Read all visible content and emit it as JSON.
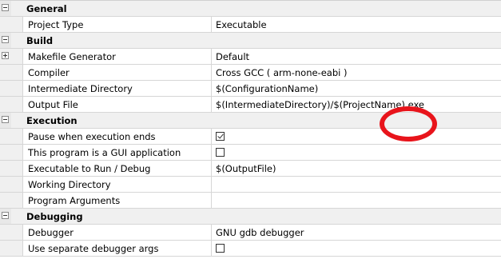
{
  "categories": {
    "general": {
      "label": "General"
    },
    "build": {
      "label": "Build"
    },
    "execution": {
      "label": "Execution"
    },
    "debugging": {
      "label": "Debugging"
    }
  },
  "properties": {
    "project_type": {
      "name": "Project Type",
      "value": "Executable"
    },
    "makefile_generator": {
      "name": "Makefile Generator",
      "value": "Default"
    },
    "compiler": {
      "name": "Compiler",
      "value": "Cross GCC ( arm-none-eabi )"
    },
    "intermediate_directory": {
      "name": "Intermediate Directory",
      "value": "$(ConfigurationName)"
    },
    "output_file": {
      "name": "Output File",
      "value": "$(IntermediateDirectory)/$(ProjectName).exe"
    },
    "pause_when_execution_ends": {
      "name": "Pause when execution ends",
      "checked": true
    },
    "gui_application": {
      "name": "This program is a GUI application",
      "checked": false
    },
    "executable_to_run": {
      "name": "Executable to Run / Debug",
      "value": "$(OutputFile)"
    },
    "working_directory": {
      "name": "Working Directory",
      "value": ""
    },
    "program_arguments": {
      "name": "Program Arguments",
      "value": ""
    },
    "debugger": {
      "name": "Debugger",
      "value": "GNU gdb debugger"
    },
    "separate_debugger_args": {
      "name": "Use separate debugger args",
      "checked": false
    }
  },
  "colors": {
    "annotation_circle": "#e8141b",
    "category_background": "#f0f0f0",
    "grid_line": "#d6d6d6"
  }
}
